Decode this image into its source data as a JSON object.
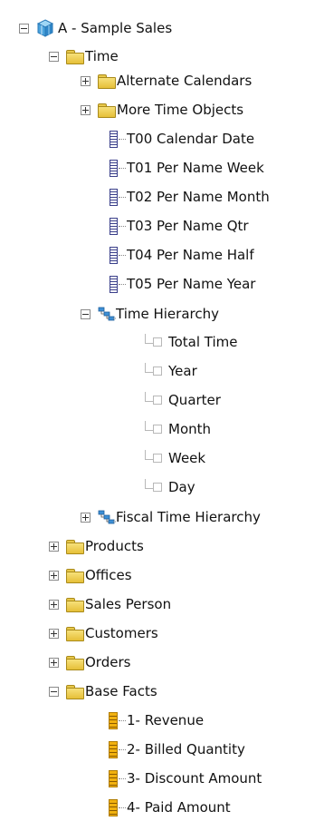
{
  "tree": {
    "root": {
      "label": "A - Sample Sales"
    },
    "time": {
      "label": "Time",
      "folders": [
        "Alternate Calendars",
        "More Time Objects"
      ],
      "columns": [
        "T00 Calendar Date",
        "T01 Per Name Week",
        "T02 Per Name Month",
        "T03 Per Name Qtr",
        "T04 Per Name Half",
        "T05 Per Name Year"
      ],
      "hierarchy": {
        "label": "Time Hierarchy",
        "levels": [
          "Total Time",
          "Year",
          "Quarter",
          "Month",
          "Week",
          "Day"
        ]
      },
      "fiscal_hierarchy": {
        "label": "Fiscal Time Hierarchy"
      }
    },
    "folders": [
      "Products",
      "Offices",
      "Sales Person",
      "Customers",
      "Orders"
    ],
    "base_facts": {
      "label": "Base Facts",
      "measures": [
        "1- Revenue",
        "2- Billed Quantity",
        "3- Discount Amount",
        "4- Paid Amount"
      ]
    }
  }
}
